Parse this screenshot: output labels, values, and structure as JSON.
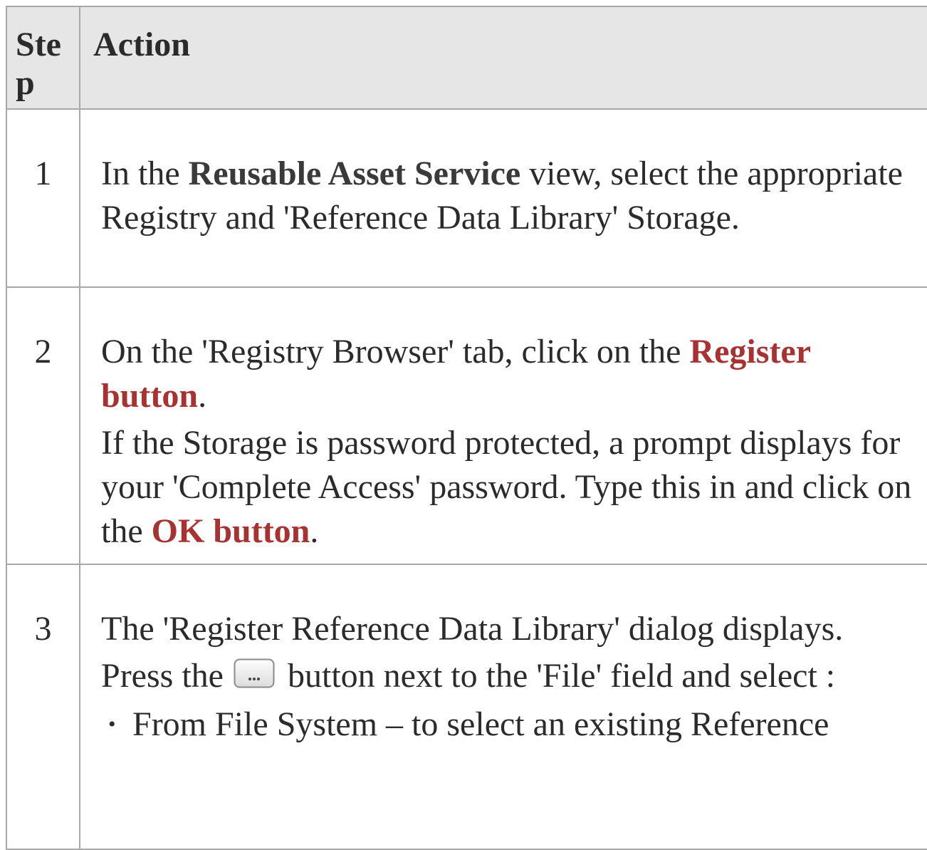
{
  "table": {
    "header": {
      "step": "Step",
      "action": "Action"
    },
    "rows": [
      {
        "step": "1",
        "p1": {
          "t1": "In the ",
          "b1": "Reusable Asset Service",
          "t2": " view, select the appropriate Registry and 'Reference Data Library' Storage."
        }
      },
      {
        "step": "2",
        "p1": {
          "t1": "On the 'Registry Browser' tab, click on the ",
          "link1": "Register button",
          "t2": "."
        },
        "p2": {
          "t1": "If the Storage is password protected, a prompt displays for your 'Complete Access' password. Type this in and click on the ",
          "link1": "OK button",
          "t2": "."
        }
      },
      {
        "step": "3",
        "p1": "The 'Register Reference Data Library' dialog displays.",
        "p2": {
          "t1": "Press the ",
          "button_icon": "ellipsis-button-icon",
          "t2": " button next to the 'File' field and select :"
        },
        "bullets": [
          "From File System – to select an existing Reference"
        ]
      }
    ]
  }
}
